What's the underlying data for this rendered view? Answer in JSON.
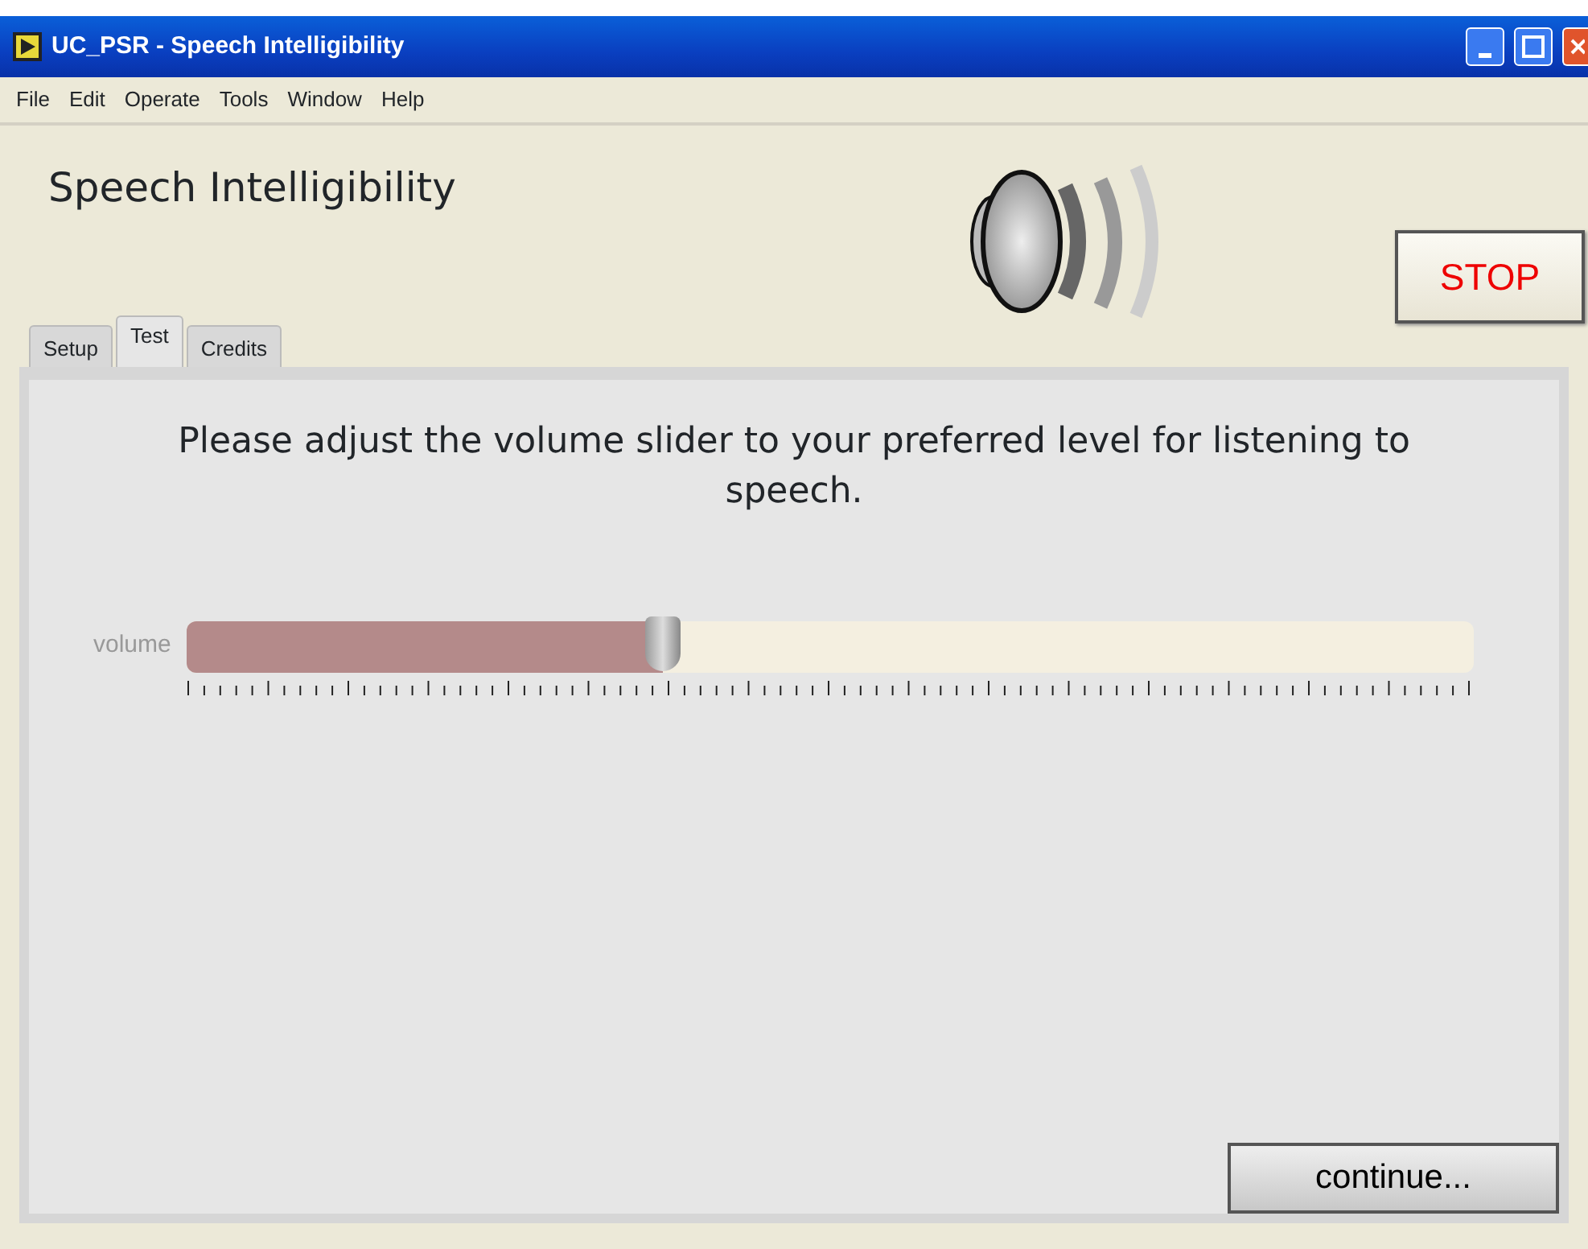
{
  "window": {
    "title": "UC_PSR - Speech Intelligibility"
  },
  "menu": [
    "File",
    "Edit",
    "Operate",
    "Tools",
    "Window",
    "Help"
  ],
  "heading": "Speech Intelligibility",
  "stop_button": "STOP",
  "tabs": [
    {
      "label": "Setup",
      "selected": false
    },
    {
      "label": "Test",
      "selected": true
    },
    {
      "label": "Credits",
      "selected": false
    }
  ],
  "instruction": "Please adjust the volume slider to your preferred level for listening to speech.",
  "slider": {
    "label": "volume",
    "level": 0.37
  },
  "continue_button": "continue..."
}
